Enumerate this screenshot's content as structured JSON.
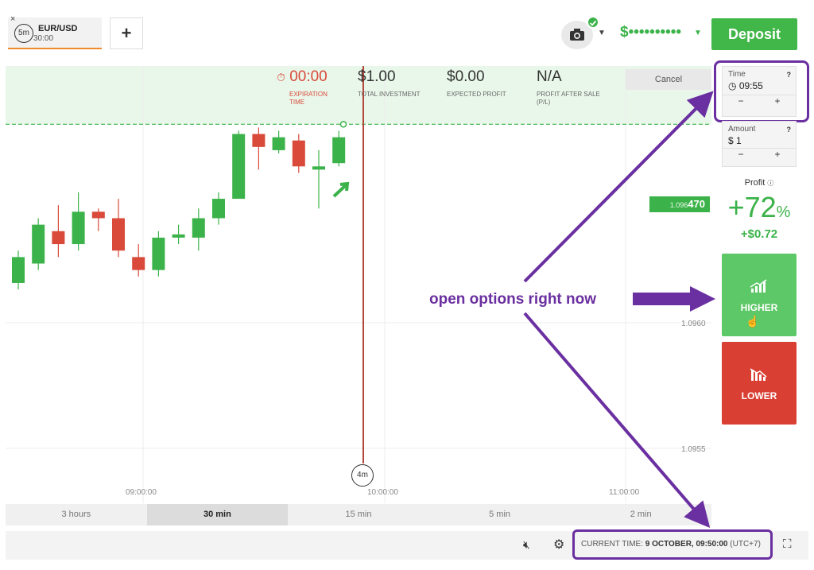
{
  "asset_tab": {
    "close": "×",
    "badge": "5m",
    "name": "EUR/USD",
    "sub": "30:00"
  },
  "add_tab": "+",
  "balance": "$••••••••••",
  "deposit": "Deposit",
  "stats": {
    "expiration": {
      "value": "00:00",
      "label": "EXPIRATION TIME"
    },
    "investment": {
      "value": "$1.00",
      "label": "TOTAL INVESTMENT"
    },
    "profit": {
      "value": "$0.00",
      "label": "EXPECTED PROFIT"
    },
    "after_sale": {
      "value": "N/A",
      "label": "PROFIT AFTER SALE (P/L)"
    }
  },
  "cancel": "Cancel",
  "price_tag": {
    "small": "1.096",
    "big": "470"
  },
  "y_ticks": [
    "1.0960",
    "1.0955"
  ],
  "x_ticks": [
    "09:00:00",
    "10:00:00",
    "11:00:00"
  ],
  "timer": "4m",
  "timeframes": [
    {
      "label": "3 hours",
      "active": false
    },
    {
      "label": "30 min",
      "active": true
    },
    {
      "label": "15 min",
      "active": false
    },
    {
      "label": "5 min",
      "active": false
    },
    {
      "label": "2 min",
      "active": false
    }
  ],
  "bottom": {
    "time_label": "CURRENT TIME:",
    "time_value": "9 OCTOBER, 09:50:00",
    "tz": "(UTC+7)"
  },
  "panel": {
    "time_label": "Time",
    "time_value": "09:55",
    "amount_label": "Amount",
    "amount_value": "$ 1",
    "minus": "−",
    "plus": "+",
    "q": "?",
    "profit_label": "Profit",
    "profit_pct": "+72",
    "pct_sign": "%",
    "profit_amt": "+$0.72",
    "higher": "HIGHER",
    "lower": "LOWER"
  },
  "annotation": "open options right now",
  "colors": {
    "green": "#3cb34a",
    "red": "#d93f33",
    "purple": "#6a2fa0"
  },
  "chart_data": {
    "type": "candlestick",
    "candles": [
      {
        "o": 1.09598,
        "c": 1.09606,
        "h": 1.09608,
        "l": 1.09596,
        "dir": "up"
      },
      {
        "o": 1.09604,
        "c": 1.09616,
        "h": 1.09618,
        "l": 1.09602,
        "dir": "up"
      },
      {
        "o": 1.09614,
        "c": 1.0961,
        "h": 1.09622,
        "l": 1.09606,
        "dir": "down"
      },
      {
        "o": 1.0961,
        "c": 1.0962,
        "h": 1.09626,
        "l": 1.09608,
        "dir": "up"
      },
      {
        "o": 1.0962,
        "c": 1.09618,
        "h": 1.09621,
        "l": 1.09614,
        "dir": "down"
      },
      {
        "o": 1.09618,
        "c": 1.09608,
        "h": 1.09624,
        "l": 1.09606,
        "dir": "down"
      },
      {
        "o": 1.09606,
        "c": 1.09602,
        "h": 1.0961,
        "l": 1.096,
        "dir": "down"
      },
      {
        "o": 1.09602,
        "c": 1.09612,
        "h": 1.09614,
        "l": 1.096,
        "dir": "up"
      },
      {
        "o": 1.09612,
        "c": 1.09613,
        "h": 1.09616,
        "l": 1.0961,
        "dir": "up"
      },
      {
        "o": 1.09612,
        "c": 1.09618,
        "h": 1.09621,
        "l": 1.09608,
        "dir": "up"
      },
      {
        "o": 1.09618,
        "c": 1.09624,
        "h": 1.09626,
        "l": 1.09616,
        "dir": "up"
      },
      {
        "o": 1.09624,
        "c": 1.09644,
        "h": 1.09645,
        "l": 1.09624,
        "dir": "up"
      },
      {
        "o": 1.09644,
        "c": 1.0964,
        "h": 1.09646,
        "l": 1.09633,
        "dir": "down"
      },
      {
        "o": 1.09639,
        "c": 1.09643,
        "h": 1.09645,
        "l": 1.09638,
        "dir": "up"
      },
      {
        "o": 1.09642,
        "c": 1.09634,
        "h": 1.09644,
        "l": 1.09632,
        "dir": "down"
      },
      {
        "o": 1.09633,
        "c": 1.09634,
        "h": 1.09639,
        "l": 1.09621,
        "dir": "up"
      },
      {
        "o": 1.09635,
        "c": 1.09643,
        "h": 1.09645,
        "l": 1.09634,
        "dir": "up"
      }
    ],
    "current_price": 1.09647,
    "ylim": [
      1.0953,
      1.09665
    ]
  }
}
